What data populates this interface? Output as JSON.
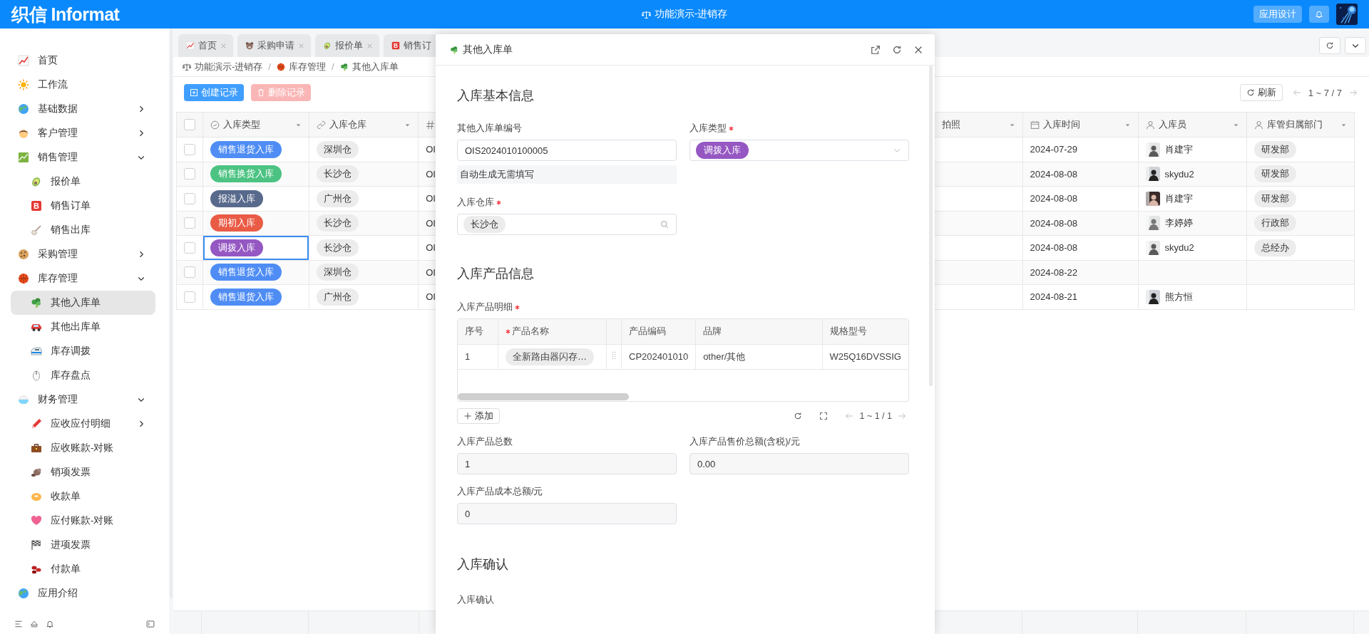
{
  "topbar": {
    "logo": "织信 Informat",
    "title": "功能演示-进销存",
    "design_button": "应用设计"
  },
  "sidebar": {
    "items": [
      {
        "label": "首页",
        "kind": "link",
        "selected": false
      },
      {
        "label": "工作流",
        "kind": "link",
        "selected": false
      },
      {
        "label": "基础数据",
        "kind": "group",
        "expanded": false,
        "selected": false
      },
      {
        "label": "客户管理",
        "kind": "group",
        "expanded": false,
        "selected": false
      },
      {
        "label": "销售管理",
        "kind": "group",
        "expanded": true,
        "selected": false,
        "children": [
          {
            "label": "报价单",
            "kind": "link",
            "selected": false
          },
          {
            "label": "销售订单",
            "kind": "link",
            "selected": false,
            "icon_letter": "B"
          },
          {
            "label": "销售出库",
            "kind": "link",
            "selected": false
          }
        ]
      },
      {
        "label": "采购管理",
        "kind": "group",
        "expanded": false,
        "selected": false
      },
      {
        "label": "库存管理",
        "kind": "group",
        "expanded": true,
        "selected": false,
        "children": [
          {
            "label": "其他入库单",
            "kind": "link",
            "selected": true
          },
          {
            "label": "其他出库单",
            "kind": "link",
            "selected": false
          },
          {
            "label": "库存调拨",
            "kind": "link",
            "selected": false
          },
          {
            "label": "库存盘点",
            "kind": "link",
            "selected": false
          }
        ]
      },
      {
        "label": "财务管理",
        "kind": "group",
        "expanded": true,
        "selected": false,
        "children": [
          {
            "label": "应收应付明细",
            "kind": "group",
            "expanded": false,
            "selected": false
          },
          {
            "label": "应收账款-对账",
            "kind": "link",
            "selected": false
          },
          {
            "label": "销项发票",
            "kind": "link",
            "selected": false
          },
          {
            "label": "收款单",
            "kind": "link",
            "selected": false
          },
          {
            "label": "应付账款-对账",
            "kind": "link",
            "selected": false
          },
          {
            "label": "进项发票",
            "kind": "link",
            "selected": false
          },
          {
            "label": "付款单",
            "kind": "link",
            "selected": false
          }
        ]
      },
      {
        "label": "应用介绍",
        "kind": "link",
        "selected": false
      }
    ]
  },
  "tabs": [
    {
      "label": "首页",
      "selected": false,
      "close_visible": true
    },
    {
      "label": "采购申请",
      "selected": false,
      "close_visible": true
    },
    {
      "label": "报价单",
      "selected": false,
      "close_visible": true
    },
    {
      "label": "销售订",
      "selected": false,
      "close_visible": false,
      "icon_letter": "B"
    }
  ],
  "breadcrumb": {
    "separator": "/",
    "items": [
      "功能演示-进销存",
      "库存管理",
      "其他入库单"
    ]
  },
  "toolbar": {
    "create_button": "创建记录",
    "delete_button": {
      "label": "删除记录",
      "disabled": true
    },
    "refresh_button": "刷新",
    "pagination": "1 ~ 7 / 7"
  },
  "table": {
    "all_checked": false,
    "columns": [
      {
        "kind": "option",
        "label": "入库类型"
      },
      {
        "kind": "relation",
        "label": "入库仓库"
      },
      {
        "kind": "number"
      },
      {
        "label": "拍照"
      },
      {
        "kind": "date",
        "label": "入库时间"
      },
      {
        "kind": "user",
        "label": "入库员"
      },
      {
        "kind": "user",
        "label": "库管归属部门"
      }
    ],
    "rows": [
      {
        "checked": false,
        "focused": false,
        "type": {
          "label": "销售退货入库",
          "color": "#4f8df5"
        },
        "warehouse": "深圳仓",
        "column_3": "OI",
        "date": "2024-07-29",
        "operator": "肖建宇",
        "department": "研发部"
      },
      {
        "checked": false,
        "focused": false,
        "type": {
          "label": "销售换货入库",
          "color": "#4cc382"
        },
        "warehouse": "长沙仓",
        "column_3": "OI",
        "date": "2024-08-08",
        "operator": "skydu2",
        "department": "研发部"
      },
      {
        "checked": false,
        "focused": false,
        "type": {
          "label": "报溢入库",
          "color": "#586a8c"
        },
        "warehouse": "广州仓",
        "column_3": "OI",
        "date": "2024-08-08",
        "operator": "肖建宇",
        "department": "研发部"
      },
      {
        "checked": false,
        "focused": false,
        "type": {
          "label": "期初入库",
          "color": "#ea5b46"
        },
        "warehouse": "长沙仓",
        "column_3": "OI",
        "date": "2024-08-08",
        "operator": "李婷婷",
        "department": "行政部"
      },
      {
        "checked": false,
        "focused": true,
        "type": {
          "label": "调拨入库",
          "color": "#9557c2"
        },
        "warehouse": "长沙仓",
        "column_3": "OI",
        "date": "2024-08-08",
        "operator": "skydu2",
        "department": "总经办"
      },
      {
        "checked": false,
        "focused": false,
        "type": {
          "label": "销售退货入库",
          "color": "#4f8df5"
        },
        "warehouse": "深圳仓",
        "column_3": "OI",
        "date": "2024-08-22"
      },
      {
        "checked": false,
        "focused": false,
        "type": {
          "label": "销售退货入库",
          "color": "#4f8df5"
        },
        "warehouse": "广州仓",
        "column_3": "OI",
        "date": "2024-08-21",
        "operator": "熊方恒"
      }
    ]
  },
  "dialog": {
    "title": "其他入库单",
    "sections": [
      {
        "title": "入库基本信息",
        "fields": [
          {
            "kind": "text",
            "label": "其他入库单编号",
            "required": false,
            "readonly": false,
            "value": "OIS2024010100005",
            "hint": "自动生成无需填写"
          },
          {
            "kind": "select",
            "label": "入库类型",
            "required": true,
            "tag": {
              "label": "调拨入库",
              "color": "#9557c2"
            }
          },
          {
            "kind": "lookup",
            "label": "入库仓库",
            "required": true,
            "tag": {
              "label": "长沙仓"
            }
          }
        ]
      },
      {
        "title": "入库产品信息",
        "fields": [
          {
            "kind": "subtable",
            "label": "入库产品明细",
            "required": true,
            "columns": [
              {
                "label": "序号",
                "required": false
              },
              {
                "label": "产品名称",
                "required": true
              },
              {
                "kind": "handle"
              },
              {
                "label": "产品编码",
                "required": false
              },
              {
                "label": "品牌",
                "required": false
              },
              {
                "label": "规格型号",
                "required": false
              }
            ],
            "rows": [
              {
                "cells": [
                  "1",
                  "全新路由器闪存…",
                  "",
                  "CP202401010",
                  "other/其他",
                  "W25Q16DVSSIG"
                ]
              }
            ],
            "add_button": "添加",
            "pagination": "1 ~ 1 / 1"
          },
          {
            "kind": "text",
            "label": "入库产品总数",
            "required": false,
            "readonly": true,
            "value": "1"
          },
          {
            "kind": "text",
            "label": "入库产品售价总额(含税)/元",
            "required": false,
            "readonly": true,
            "value": "0.00"
          },
          {
            "kind": "text",
            "label": "入库产品成本总额/元",
            "required": false,
            "readonly": true,
            "value": "0"
          }
        ]
      },
      {
        "title": "入库确认",
        "fields": [
          {
            "kind": "label",
            "label": "入库确认",
            "required": false
          }
        ]
      }
    ]
  }
}
